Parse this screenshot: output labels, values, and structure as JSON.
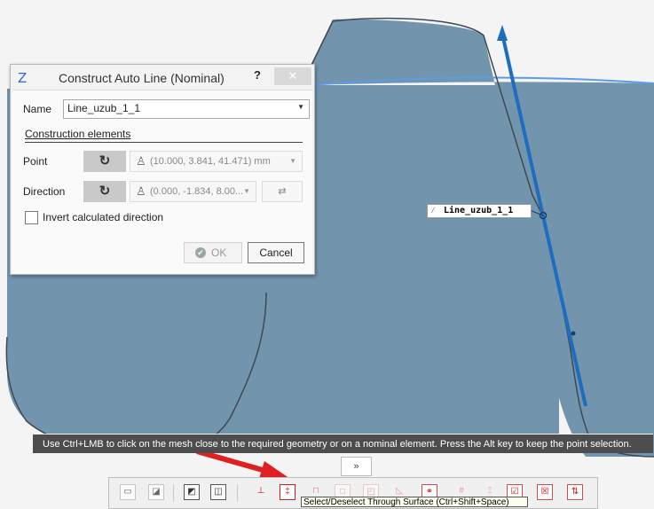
{
  "colors": {
    "viewport_bg": "#f4f4f4",
    "surface_fill": "#7394ad",
    "surface_edge": "#5b9be8",
    "line_blue": "#1e6ebd",
    "arrow_red": "#e02020",
    "status_bg": "#4d4d4d"
  },
  "dialog": {
    "icon": "construct-line-icon",
    "title": "Construct Auto Line (Nominal)",
    "help_label": "?",
    "close_label": "✕",
    "name_label": "Name",
    "name_value": "Line_uzub_1_1",
    "section_title": "Construction elements",
    "point_label": "Point",
    "point_value": "(10.000, 3.841, 41.471) mm",
    "direction_label": "Direction",
    "direction_value": "(0.000, -1.834, 8.00...",
    "swap_label": "⇄",
    "invert_label": "Invert calculated direction",
    "invert_checked": false,
    "ok_label": "OK",
    "cancel_label": "Cancel"
  },
  "viewport": {
    "line_label": "Line_uzub_1_1"
  },
  "status_message": "Use Ctrl+LMB to click on the mesh close to the required geometry or on a nominal element. Press the Alt key to keep the point selection.",
  "expand_label": "»",
  "toolbar": {
    "tooltip": "Select/Deselect Through Surface (Ctrl+Shift+Space)",
    "active_tool": "select-through-surface"
  }
}
